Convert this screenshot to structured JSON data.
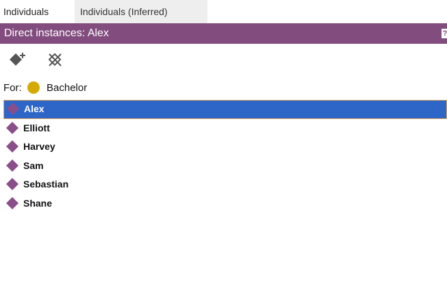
{
  "tabs": [
    {
      "label": "Individuals",
      "active": true
    },
    {
      "label": "Individuals (Inferred)",
      "active": false
    }
  ],
  "header": {
    "title": "Direct instances: Alex",
    "accent_color": "#824c7f",
    "help_glyph": "?"
  },
  "toolbar": {
    "add_individual_icon": "add-individual-icon",
    "delete_individual_icon": "delete-individual-icon"
  },
  "for_class": {
    "label": "For:",
    "class_name": "Bachelor",
    "class_color": "#d4aa07"
  },
  "individuals": {
    "selected": "Alex",
    "items": [
      "Alex",
      "Elliott",
      "Harvey",
      "Sam",
      "Sebastian",
      "Shane"
    ],
    "icon_color": "#8a4f8a",
    "selection_color": "#2e66c8"
  }
}
